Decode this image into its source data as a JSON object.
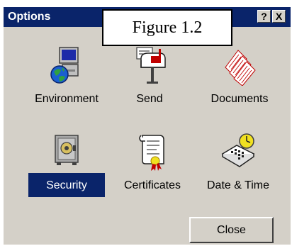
{
  "window": {
    "title": "Options"
  },
  "titlebar_buttons": {
    "help": "?",
    "close": "X"
  },
  "caption": "Figure 1.2",
  "items": [
    {
      "label": "Environment",
      "icon": "computer-globe-icon",
      "selected": false
    },
    {
      "label": "Send",
      "icon": "mailbox-icon",
      "selected": false
    },
    {
      "label": "Documents",
      "icon": "documents-icon",
      "selected": false
    },
    {
      "label": "Security",
      "icon": "safe-icon",
      "selected": true
    },
    {
      "label": "Certificates",
      "icon": "certificate-icon",
      "selected": false
    },
    {
      "label": "Date & Time",
      "icon": "calendar-clock-icon",
      "selected": false
    }
  ],
  "buttons": {
    "close": "Close"
  },
  "colors": {
    "title_bar": "#0a246a",
    "selection": "#0a246a",
    "face": "#d4d0c8"
  }
}
